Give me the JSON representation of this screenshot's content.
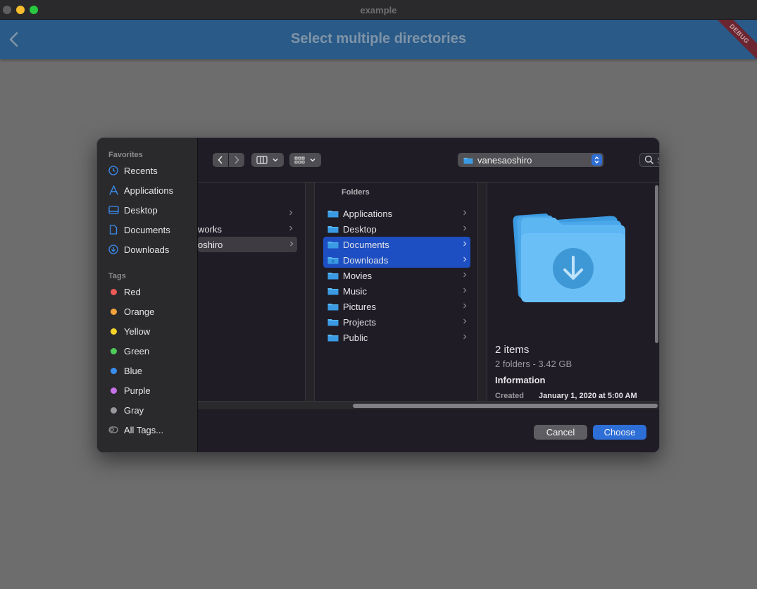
{
  "window": {
    "title": "example"
  },
  "appbar": {
    "title": "Select multiple directories",
    "debug_label": "DEBUG"
  },
  "sidebar": {
    "favorites_heading": "Favorites",
    "favorites": [
      {
        "label": "Recents",
        "icon": "clock-icon"
      },
      {
        "label": "Applications",
        "icon": "applications-icon"
      },
      {
        "label": "Desktop",
        "icon": "desktop-icon"
      },
      {
        "label": "Documents",
        "icon": "document-icon"
      },
      {
        "label": "Downloads",
        "icon": "download-icon"
      }
    ],
    "tags_heading": "Tags",
    "tags": [
      {
        "label": "Red",
        "color": "#ec5a57"
      },
      {
        "label": "Orange",
        "color": "#f3a33a"
      },
      {
        "label": "Yellow",
        "color": "#f5d328"
      },
      {
        "label": "Green",
        "color": "#4fcb5a"
      },
      {
        "label": "Blue",
        "color": "#3a8ef0"
      },
      {
        "label": "Purple",
        "color": "#c672e6"
      },
      {
        "label": "Gray",
        "color": "#98989c"
      }
    ],
    "all_tags": "All Tags..."
  },
  "toolbar": {
    "path_label": "vanesaoshiro",
    "search_placeholder": "Search"
  },
  "browser": {
    "col1_items": [
      "",
      "works",
      "oshiro"
    ],
    "folders_header": "Folders",
    "folders": [
      {
        "label": "Applications",
        "selected": false
      },
      {
        "label": "Desktop",
        "selected": false
      },
      {
        "label": "Documents",
        "selected": true
      },
      {
        "label": "Downloads",
        "selected": true
      },
      {
        "label": "Movies",
        "selected": false
      },
      {
        "label": "Music",
        "selected": false
      },
      {
        "label": "Pictures",
        "selected": false
      },
      {
        "label": "Projects",
        "selected": false
      },
      {
        "label": "Public",
        "selected": false
      }
    ],
    "preview": {
      "title": "2 items",
      "subtitle": "2 folders - 3.42 GB",
      "info_heading": "Information",
      "created_label": "Created",
      "created_value": "January 1, 2020 at 5:00 AM"
    }
  },
  "footer": {
    "cancel_label": "Cancel",
    "choose_label": "Choose"
  },
  "colors": {
    "accent": "#2d6fd7",
    "selection": "#1e4fc2",
    "appbar": "#2a5a87"
  }
}
